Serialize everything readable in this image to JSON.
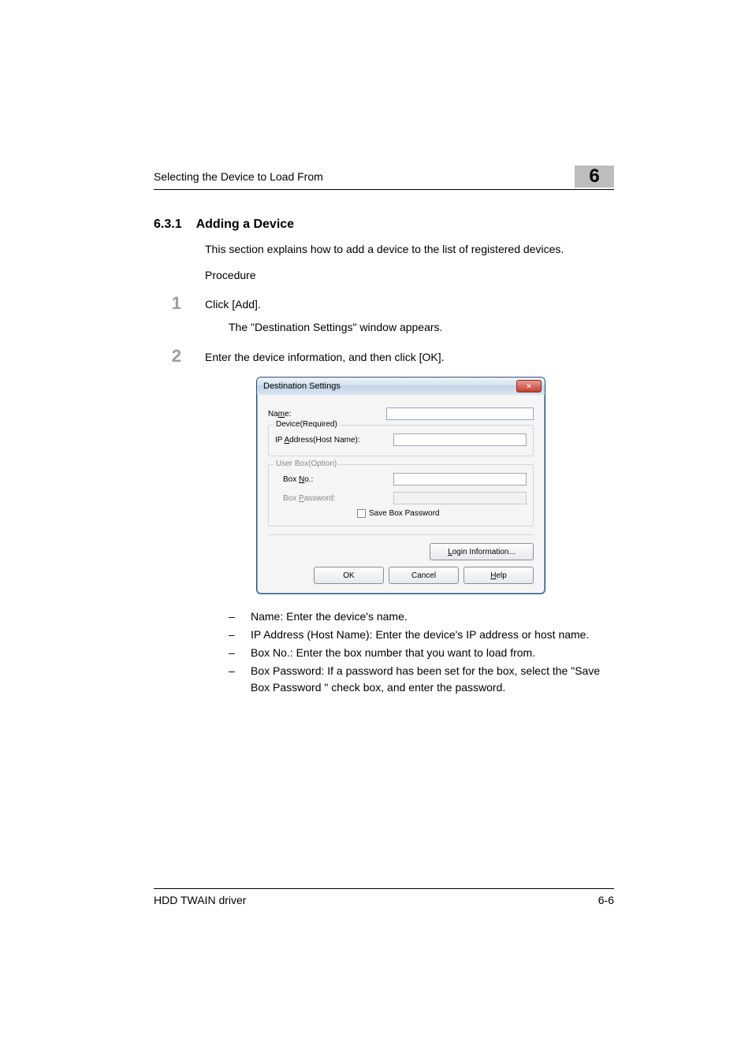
{
  "header": {
    "running_title": "Selecting the Device to Load From",
    "chapter_number": "6"
  },
  "section": {
    "number": "6.3.1",
    "title": "Adding a Device",
    "intro": "This section explains how to add a device to the list of registered devices.",
    "procedure_label": "Procedure"
  },
  "steps": [
    {
      "num": "1",
      "text": "Click [Add].",
      "sub": "The \"Destination Settings\" window appears."
    },
    {
      "num": "2",
      "text": "Enter the device information, and then click [OK]."
    }
  ],
  "dialog": {
    "title": "Destination Settings",
    "name_label_pre": "Na",
    "name_label_u": "m",
    "name_label_post": "e:",
    "device_group": "Device(Required)",
    "ip_label_pre": "IP ",
    "ip_label_u": "A",
    "ip_label_post": "ddress(Host Name):",
    "userbox_group": "User Box(Option)",
    "boxno_label_pre": "Box ",
    "boxno_label_u": "N",
    "boxno_label_post": "o.:",
    "boxpw_label_pre": "Box ",
    "boxpw_label_u": "P",
    "boxpw_label_post": "assword:",
    "save_pw_u": "S",
    "save_pw_post": "ave Box Password",
    "login_u": "L",
    "login_post": "ogin Information...",
    "ok": "OK",
    "cancel": "Cancel",
    "help_u": "H",
    "help_post": "elp"
  },
  "bullets": [
    "Name: Enter the device's name.",
    "IP Address (Host Name): Enter the device's IP address or host name.",
    "Box No.: Enter the box number that you want to load from.",
    "Box Password: If a password has been set for the box, select the \"Save Box Password \" check box, and enter the password."
  ],
  "footer": {
    "left": "HDD TWAIN driver",
    "right": "6-6"
  }
}
